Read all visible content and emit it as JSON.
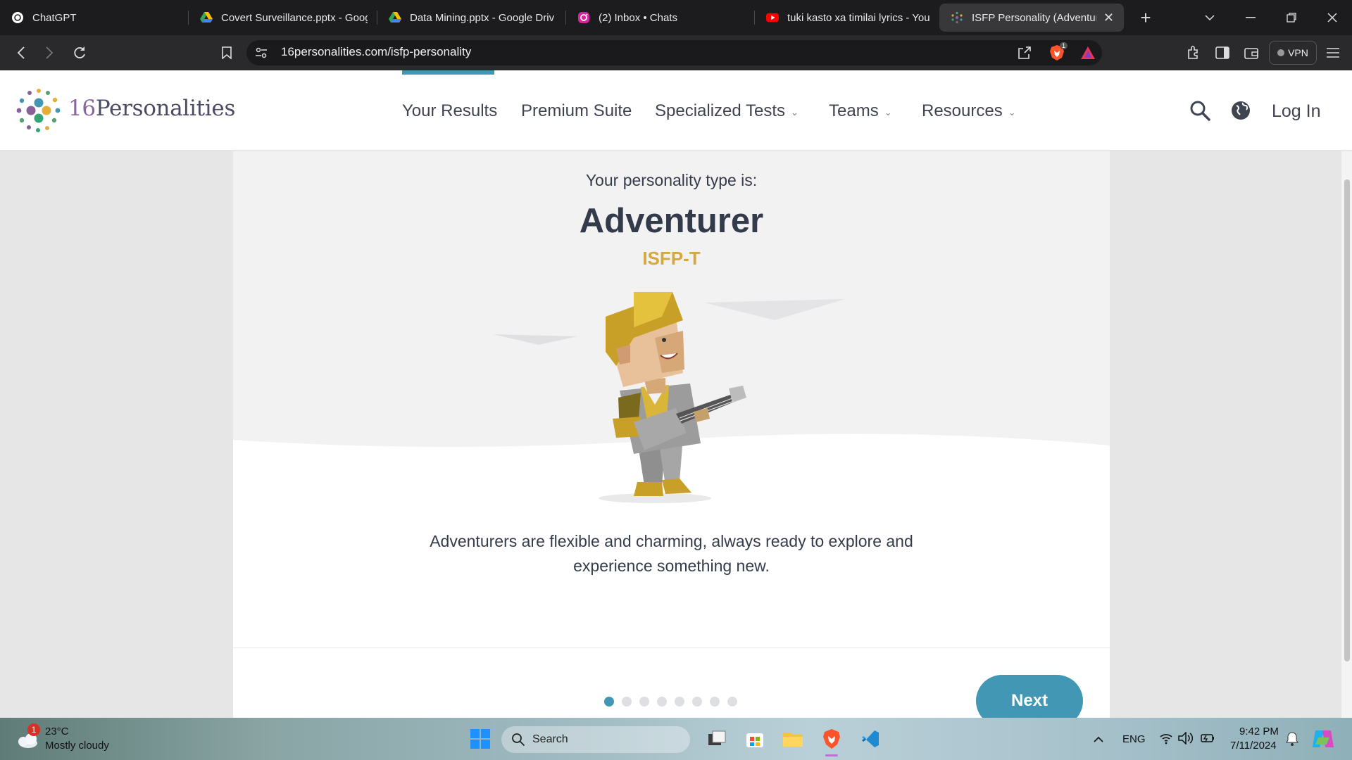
{
  "browser": {
    "tabs": [
      {
        "label": "ChatGPT",
        "icon": "chatgpt-icon"
      },
      {
        "label": "Covert Surveillance.pptx - Goog",
        "icon": "google-drive-icon"
      },
      {
        "label": "Data Mining.pptx - Google Driv",
        "icon": "google-drive-icon"
      },
      {
        "label": "(2) Inbox • Chats",
        "icon": "instagram-icon"
      },
      {
        "label": "tuki kasto xa timilai lyrics - YouT",
        "icon": "youtube-icon"
      },
      {
        "label": "ISFP Personality (Adventure",
        "icon": "16personalities-icon",
        "active": true
      }
    ],
    "new_tab": "+",
    "url": "16personalities.com/isfp-personality",
    "vpn_label": "VPN",
    "brave_badge": "1"
  },
  "site": {
    "logo_number": "16",
    "logo_name": "Personalities",
    "nav": [
      {
        "label": "Your Results",
        "dropdown": false,
        "active": true
      },
      {
        "label": "Premium Suite",
        "dropdown": false
      },
      {
        "label": "Specialized Tests",
        "dropdown": true
      },
      {
        "label": "Teams",
        "dropdown": true
      },
      {
        "label": "Resources",
        "dropdown": true
      }
    ],
    "login": "Log In"
  },
  "result": {
    "subtitle": "Your personality type is:",
    "type_name": "Adventurer",
    "type_code": "ISFP-T",
    "description": "Adventurers are flexible and charming, always ready to explore and experience something new.",
    "next_label": "Next",
    "slides_total": 8,
    "slide_current": 1
  },
  "taskbar": {
    "weather_temp": "23°C",
    "weather_desc": "Mostly cloudy",
    "weather_badge": "1",
    "search_placeholder": "Search",
    "language": "ENG",
    "time": "9:42 PM",
    "date": "7/11/2024"
  },
  "colors": {
    "accent": "#4298b4",
    "type_code": "#d6a73a",
    "heading": "#333b4a"
  }
}
